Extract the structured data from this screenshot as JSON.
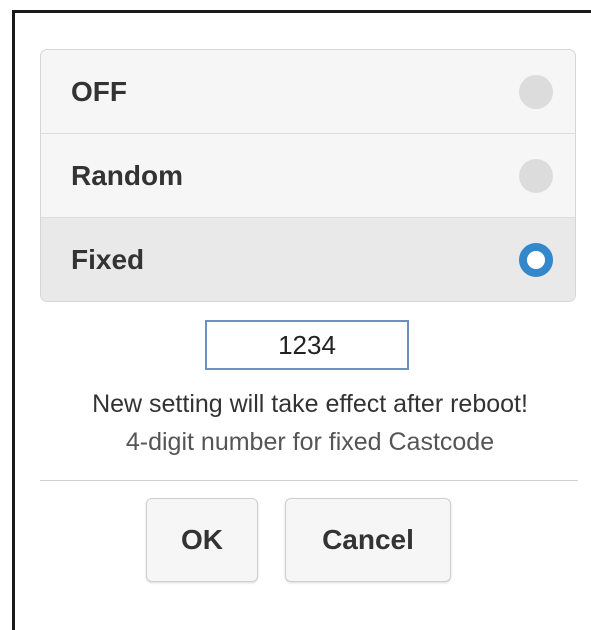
{
  "options": [
    {
      "label": "OFF",
      "selected": false
    },
    {
      "label": "Random",
      "selected": false
    },
    {
      "label": "Fixed",
      "selected": true
    }
  ],
  "castcode": {
    "value": "1234"
  },
  "messages": {
    "reboot_notice": "New setting will take effect after reboot!",
    "hint": "4-digit number for fixed Castcode"
  },
  "buttons": {
    "ok_label": "OK",
    "cancel_label": "Cancel"
  },
  "colors": {
    "accent": "#3388cc",
    "radio_off": "#dcdcdc",
    "option_bg": "#f6f6f6",
    "selected_bg": "#e9e9e9"
  }
}
